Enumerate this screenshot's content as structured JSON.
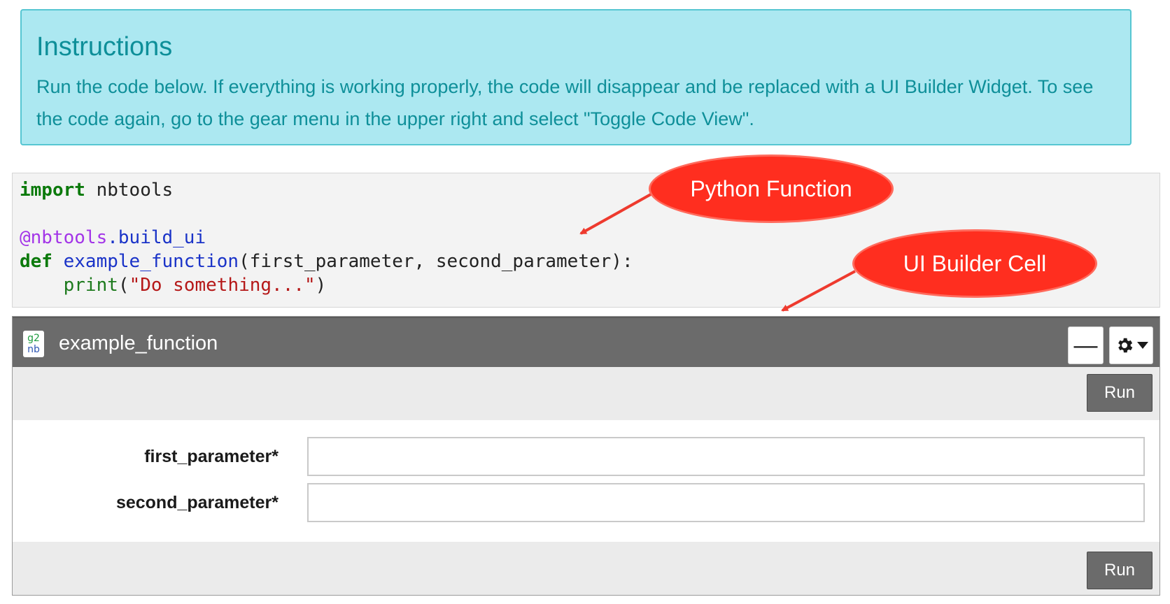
{
  "instructions": {
    "title": "Instructions",
    "body": "Run the code below.  If everything is working properly, the code will disappear and be replaced with a UI Builder Widget.  To see the code again, go to the gear menu in the upper right and select \"Toggle Code View\"."
  },
  "code": {
    "line1_kw": "import",
    "line1_mod": " nbtools",
    "line3_dec": "@nbtools",
    "line3_attr": ".build_ui",
    "line4_kw": "def",
    "line4_fn": "example_function",
    "line4_args": "(first_parameter, second_parameter):",
    "line5_indent": "    ",
    "line5_bi": "print",
    "line5_open": "(",
    "line5_str": "\"Do something...\"",
    "line5_close": ")"
  },
  "callouts": {
    "python_function": "Python Function",
    "ui_builder_cell": "UI Builder Cell"
  },
  "widget": {
    "logo_top": "g2",
    "logo_bottom": "nb",
    "title": "example_function",
    "minimize_label": "—",
    "run_label": "Run",
    "parameters": [
      {
        "label": "first_parameter*",
        "value": ""
      },
      {
        "label": "second_parameter*",
        "value": ""
      }
    ]
  },
  "colors": {
    "instructions_bg": "#ace8f1",
    "instructions_text": "#0e8f99",
    "callout_red": "#ff2e1f",
    "widget_header": "#6b6b6b"
  },
  "icons": [
    "gear-icon",
    "caret-down-icon",
    "minimize-icon",
    "g2nb-logo-icon",
    "arrow-icon"
  ]
}
